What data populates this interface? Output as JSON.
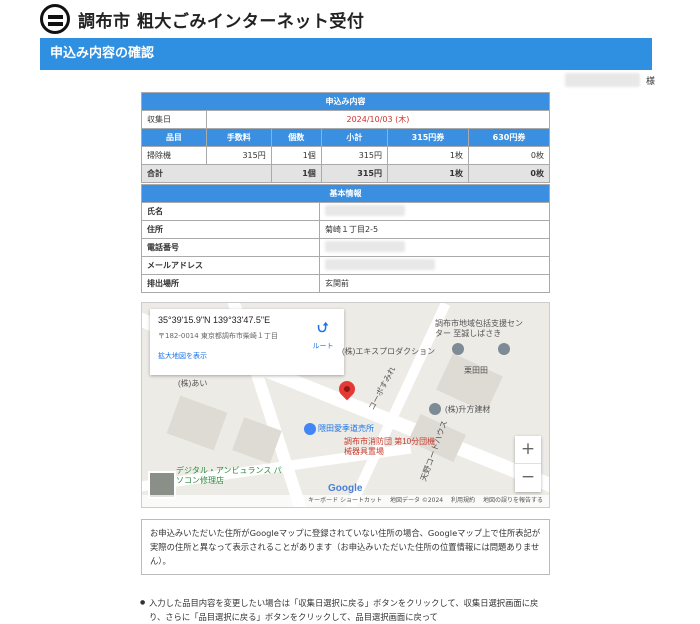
{
  "site": {
    "title": "調布市 粗大ごみインターネット受付"
  },
  "page": {
    "heading": "申込み内容の確認"
  },
  "user": {
    "suffix": "様"
  },
  "application": {
    "section_title": "申込み内容",
    "collection_date_label": "収集日",
    "collection_date": "2024/10/03 (木)",
    "columns": [
      "品目",
      "手数料",
      "個数",
      "小計",
      "315円券",
      "630円券"
    ],
    "rows": [
      {
        "item": "掃除機",
        "fee": "315円",
        "qty": "1個",
        "subtotal": "315円",
        "t315": "1枚",
        "t630": "0枚"
      }
    ],
    "total": {
      "label": "合計",
      "qty": "1個",
      "subtotal": "315円",
      "t315": "1枚",
      "t630": "0枚"
    }
  },
  "basic": {
    "section_title": "基本情報",
    "name_label": "氏名",
    "address_label": "住所",
    "address_value": "菊崎１丁目2-5",
    "phone_label": "電話番号",
    "email_label": "メールアドレス",
    "place_label": "排出場所",
    "place_value": "玄関前"
  },
  "map": {
    "coords": "35°39'15.9\"N 139°33'47.5\"E",
    "address": "〒182-0014 東京都調布市柴崎１丁目",
    "larger_map": "拡大地図を表示",
    "route": "ルート",
    "labels": {
      "center": "調布市地域包括支援センター 至誠しばさき",
      "ekisu": "(株)エキスプロダクション",
      "ai": "(株)あい",
      "koupo": "コーポすみれ",
      "masu": "(株)升方建材",
      "kurita": "栗田田",
      "shop": "隈田愛季道売所",
      "fire": "調布市消防団 第10分団機械器具置場",
      "digital": "デジタル・アンビュランス パソコン修理店",
      "tenmu": "天野コートハウス"
    },
    "footer": {
      "shortcut": "キーボード ショートカット",
      "data": "地図データ ©2024",
      "terms": "利用規約",
      "report": "地図の誤りを報告する"
    },
    "google": "Google",
    "zoom_in": "+",
    "zoom_out": "−",
    "route_icon": "directions-icon"
  },
  "notes": {
    "box": "お申込みいただいた住所がGoogleマップに登録されていない住所の場合、Googleマップ上で住所表記が実際の住所と異なって表示されることがあります（お申込みいただいた住所の位置情報には問題ありません）。",
    "bullet": "入力した品目内容を変更したい場合は「収集日選択に戻る」ボタンをクリックして、収集日選択画面に戻り、さらに「品目選択に戻る」ボタンをクリックして、品目選択画面に戻って"
  }
}
